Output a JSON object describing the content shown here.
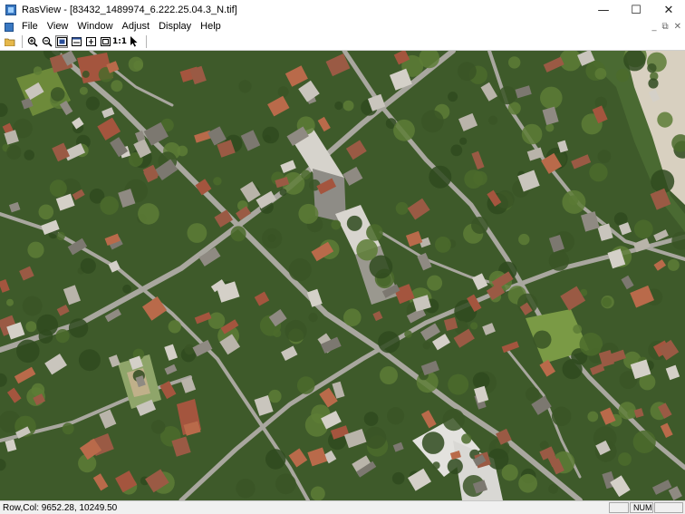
{
  "window": {
    "title": "RasView - [83432_1489974_6.222.25.04.3_N.tif]",
    "minimize_glyph": "—",
    "maximize_glyph": "☐",
    "close_glyph": "✕"
  },
  "menu": {
    "items": [
      "File",
      "View",
      "Window",
      "Adjust",
      "Display",
      "Help"
    ],
    "mdi_glyphs": [
      "_",
      "⧉",
      "✕"
    ]
  },
  "toolbar": {
    "buttons": [
      {
        "icon": "open-folder-icon"
      },
      {
        "icon": "zoom-in-icon"
      },
      {
        "icon": "zoom-out-icon"
      },
      {
        "icon": "fit-window-icon"
      },
      {
        "icon": "fit-width-icon"
      },
      {
        "icon": "fit-height-icon"
      },
      {
        "icon": "full-extent-icon"
      },
      {
        "icon": "one-to-one-icon",
        "label": "1:1"
      },
      {
        "icon": "pointer-arrow-icon"
      }
    ]
  },
  "status": {
    "text": "Row,Col: 9652.28, 10249.50",
    "panels": [
      "",
      "NUM",
      ""
    ]
  },
  "colors": {
    "vegetation": "#3e5a2a",
    "road": "#a9a79f",
    "roof_light": "#c9c5bd",
    "roof_red": "#a4553e",
    "beach": "#d8d0c0"
  }
}
